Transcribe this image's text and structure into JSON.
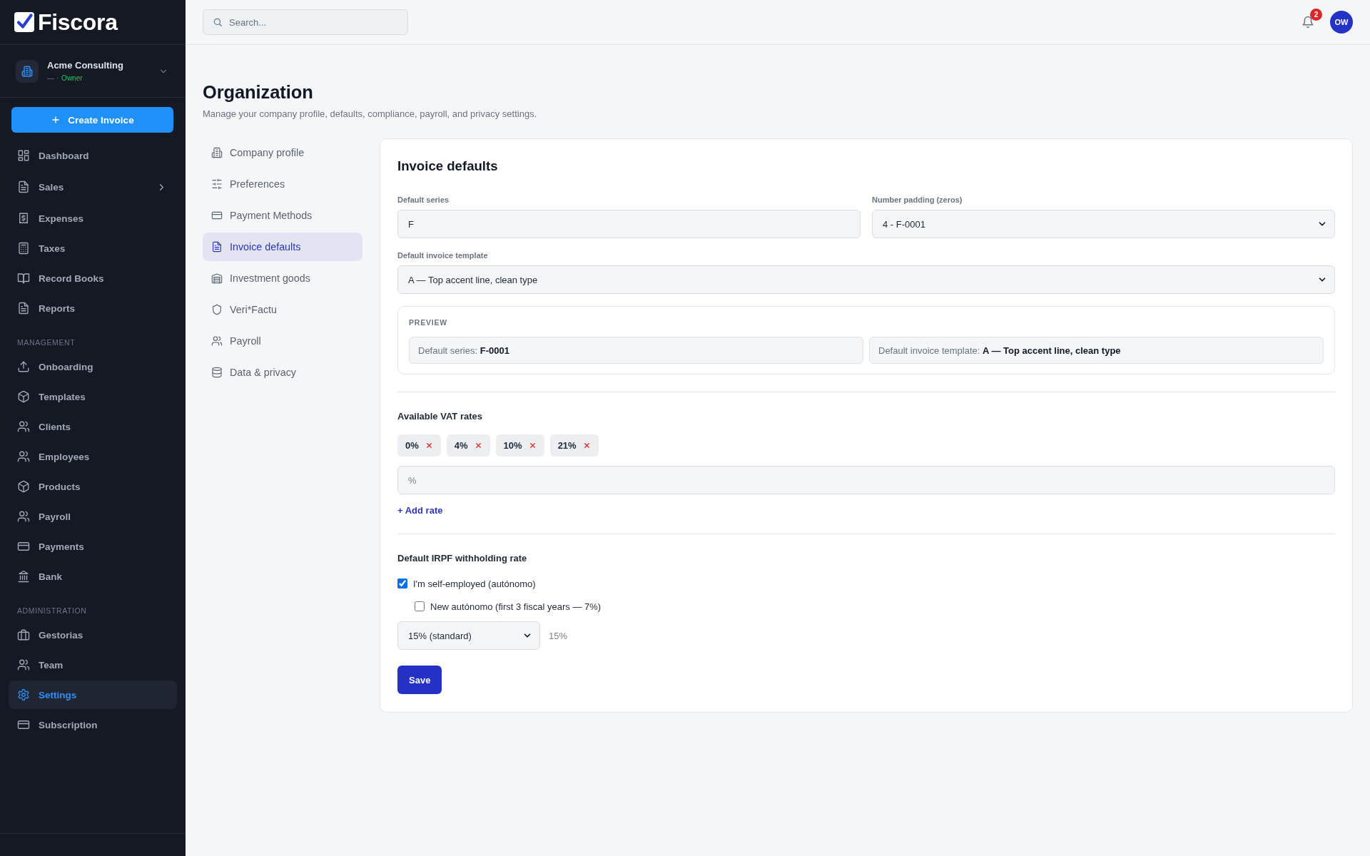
{
  "sidebar": {
    "logo": "Fiscora",
    "organization": {
      "name": "Acme Consulting",
      "detail": "— ·",
      "role": "Owner"
    },
    "create_button": "Create Invoice",
    "sections": [
      {
        "items": [
          {
            "label": "Dashboard",
            "selected": false,
            "submenu": false
          },
          {
            "label": "Sales",
            "selected": false,
            "submenu": true
          },
          {
            "label": "Expenses",
            "selected": false,
            "submenu": false
          },
          {
            "label": "Taxes",
            "selected": false,
            "submenu": false
          },
          {
            "label": "Record Books",
            "selected": false,
            "submenu": false
          },
          {
            "label": "Reports",
            "selected": false,
            "submenu": false
          }
        ]
      },
      {
        "heading": "MANAGEMENT",
        "items": [
          {
            "label": "Onboarding",
            "selected": false,
            "submenu": false
          },
          {
            "label": "Templates",
            "selected": false,
            "submenu": false
          },
          {
            "label": "Clients",
            "selected": false,
            "submenu": false
          },
          {
            "label": "Employees",
            "selected": false,
            "submenu": false
          },
          {
            "label": "Products",
            "selected": false,
            "submenu": false
          },
          {
            "label": "Payroll",
            "selected": false,
            "submenu": false
          },
          {
            "label": "Payments",
            "selected": false,
            "submenu": false
          },
          {
            "label": "Bank",
            "selected": false,
            "submenu": false
          }
        ]
      },
      {
        "heading": "ADMINISTRATION",
        "items": [
          {
            "label": "Gestorias",
            "selected": false,
            "submenu": false
          },
          {
            "label": "Team",
            "selected": false,
            "submenu": false
          },
          {
            "label": "Settings",
            "selected": true,
            "submenu": false
          },
          {
            "label": "Subscription",
            "selected": false,
            "submenu": false
          }
        ]
      }
    ]
  },
  "topbar": {
    "search": {
      "placeholder": "Search..."
    },
    "notification_count": "2",
    "avatar": "OW"
  },
  "page": {
    "title": "Organization",
    "subtitle": "Manage your company profile, defaults, compliance, payroll, and privacy settings."
  },
  "settings_nav": [
    {
      "label": "Company profile",
      "selected": false
    },
    {
      "label": "Preferences",
      "selected": false
    },
    {
      "label": "Payment Methods",
      "selected": false
    },
    {
      "label": "Invoice defaults",
      "selected": true
    },
    {
      "label": "Investment goods",
      "selected": false
    },
    {
      "label": "Veri*Factu",
      "selected": false
    },
    {
      "label": "Payroll",
      "selected": false
    },
    {
      "label": "Data & privacy",
      "selected": false
    }
  ],
  "invoice_defaults": {
    "title": "Invoice defaults",
    "field_rows": [
      [
        {
          "kind": "text",
          "label": "Default series",
          "value": "F"
        },
        {
          "kind": "select",
          "label": "Number padding (zeros)",
          "value": "4 - F-0001"
        }
      ],
      [
        {
          "kind": "select",
          "label": "Default invoice template",
          "value": "A — Top accent line, clean type"
        }
      ]
    ],
    "preview": {
      "heading": "PREVIEW",
      "items": [
        "Default series: **F-0001**",
        "Default invoice template: **A — Top accent line, clean type**"
      ]
    },
    "vat": {
      "heading": "Available VAT rates",
      "rates": [
        "0%",
        "4%",
        "10%",
        "21%"
      ],
      "input": {
        "placeholder": "%"
      },
      "add_link": "+ Add rate"
    },
    "irpf": {
      "heading": "Default IRPF withholding rate",
      "options": [
        {
          "label": "I'm self-employed (autónomo)",
          "checked": true,
          "children": [
            {
              "label": "New autónomo (first 3 fiscal years — 7%)",
              "checked": false
            }
          ]
        }
      ],
      "rate_select": {
        "value": "15% (standard)"
      },
      "rate_readout": "15%"
    },
    "save_button": "Save"
  }
}
